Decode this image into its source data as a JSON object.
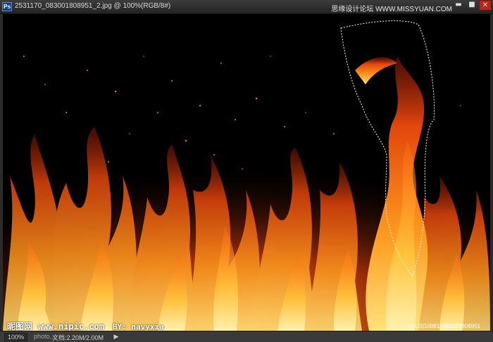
{
  "window": {
    "app_badge": "Ps",
    "title": "2531170_083001808951_2.jpg @ 100%(RGB/8#)",
    "watermark": "思缘设计论坛  WWW.MISSYUAN.COM",
    "minimize_glyph": "▬",
    "maximize_glyph": "■",
    "close_glyph": "✕"
  },
  "overlay": {
    "site_name": "昵图网",
    "site_url": "www.nipic.com",
    "author": "BY: navyxia",
    "image_no": "NO:20100818083001808951"
  },
  "status": {
    "zoom": "100%",
    "photo": "photo...",
    "doc": "文档:2.20M/2.00M",
    "arrow_glyph": "▶"
  },
  "colors": {
    "fire_core": "#ffd24a",
    "fire_mid": "#ff7a10",
    "fire_dark": "#a8240a",
    "background": "#000000"
  }
}
